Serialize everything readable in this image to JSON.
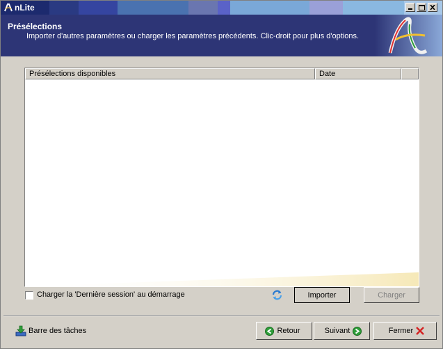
{
  "window": {
    "title": "nLite"
  },
  "header": {
    "title": "Présélections",
    "description": "Importer d'autres paramètres ou charger les paramètres précédents. Clic-droit pour plus d'options."
  },
  "list": {
    "columns": [
      "Présélections disponibles",
      "Date",
      ""
    ],
    "rows": []
  },
  "options": {
    "load_last_session_label": "Charger la 'Dernière session' au démarrage",
    "load_last_session_checked": false
  },
  "buttons": {
    "import": "Importer",
    "load": "Charger",
    "back": "Retour",
    "next": "Suivant",
    "close": "Fermer"
  },
  "taskbar": {
    "label": "Barre des tâches"
  },
  "colors": {
    "header_bg": "#2d3576",
    "back_icon": "#2e9e3a",
    "next_icon": "#2e9e3a",
    "close_icon": "#d42020"
  }
}
